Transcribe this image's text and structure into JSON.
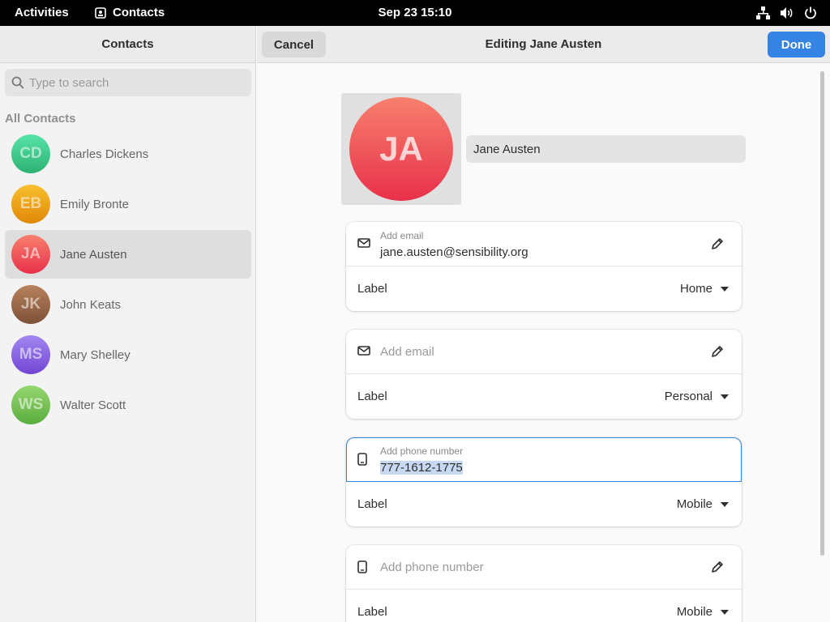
{
  "topbar": {
    "activities": "Activities",
    "app_name": "Contacts",
    "clock": "Sep 23  15:10"
  },
  "sidebar": {
    "title": "Contacts",
    "search_placeholder": "Type to search",
    "section_label": "All Contacts",
    "contacts": [
      {
        "initials": "CD",
        "name": "Charles Dickens",
        "color": "#3ec389"
      },
      {
        "initials": "EB",
        "name": "Emily Bronte",
        "color": "#f1a20d"
      },
      {
        "initials": "JA",
        "name": "Jane Austen",
        "color": "#ed3d55"
      },
      {
        "initials": "JK",
        "name": "John Keats",
        "color": "#9b6a49"
      },
      {
        "initials": "MS",
        "name": "Mary Shelley",
        "color": "#8a63dd"
      },
      {
        "initials": "WS",
        "name": "Walter Scott",
        "color": "#78c15a"
      }
    ],
    "selected": "Jane Austen"
  },
  "header": {
    "cancel": "Cancel",
    "title": "Editing Jane Austen",
    "done": "Done"
  },
  "editor": {
    "avatar_initials": "JA",
    "name": "Jane Austen",
    "email1": {
      "small_label": "Add email",
      "value": "jane.austen@sensibility.org",
      "label": "Label",
      "type": "Home"
    },
    "email2": {
      "placeholder": "Add email",
      "label": "Label",
      "type": "Personal"
    },
    "phone1": {
      "small_label": "Add phone number",
      "value": "777-1612-1775",
      "label": "Label",
      "type": "Mobile"
    },
    "phone2": {
      "placeholder": "Add phone number",
      "label": "Label",
      "type": "Mobile"
    }
  },
  "colors": {
    "accent": "#3584e4",
    "avatar_gradient_top": "#f7806e",
    "avatar_gradient_bottom": "#e8304a"
  }
}
